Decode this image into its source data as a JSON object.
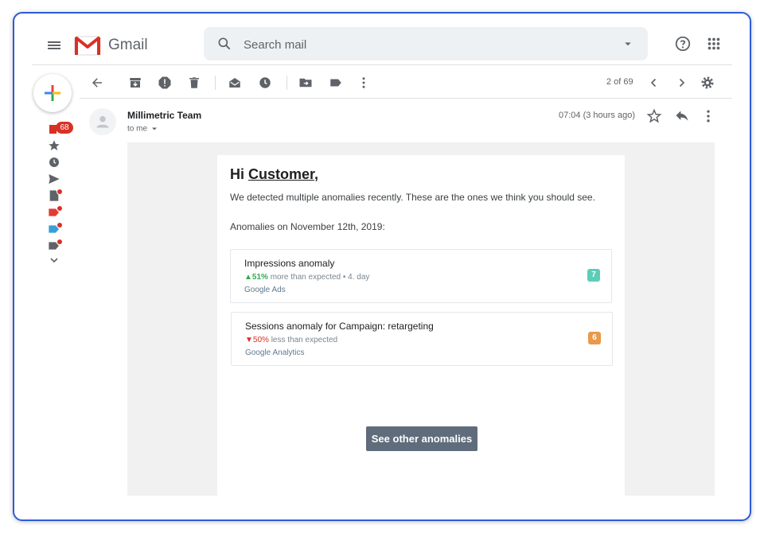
{
  "app": {
    "brand": "Gmail"
  },
  "search": {
    "placeholder": "Search mail"
  },
  "sidebar": {
    "inbox_count": "68"
  },
  "toolbar": {
    "pager": "2 of 69"
  },
  "message": {
    "sender": "Millimetric Team",
    "recipient": "to me",
    "time": "07:04 (3 hours ago)"
  },
  "email": {
    "greeting_prefix": "Hi ",
    "greeting_name": "Customer,",
    "intro": "We detected multiple anomalies recently. These are the ones we think you should see.",
    "date_line": "Anomalies on November 12th, 2019:",
    "anomalies": [
      {
        "title": "Impressions anomaly",
        "change": "▲51%",
        "change_text": " more than expected • 4. day",
        "source": "Google Ads",
        "score": "7",
        "score_color": "#5ccdb7"
      },
      {
        "title": "Sessions anomaly for Campaign: retargeting",
        "change": "▼50%",
        "change_text": " less than expected",
        "source": "Google Analytics",
        "score": "6",
        "score_color": "#e8994a"
      }
    ],
    "cta_label": "See other anomalies"
  },
  "colors": {
    "accent_frame": "#2f5bd9",
    "badge": "#d93025",
    "cta": "#5f6c7b"
  }
}
